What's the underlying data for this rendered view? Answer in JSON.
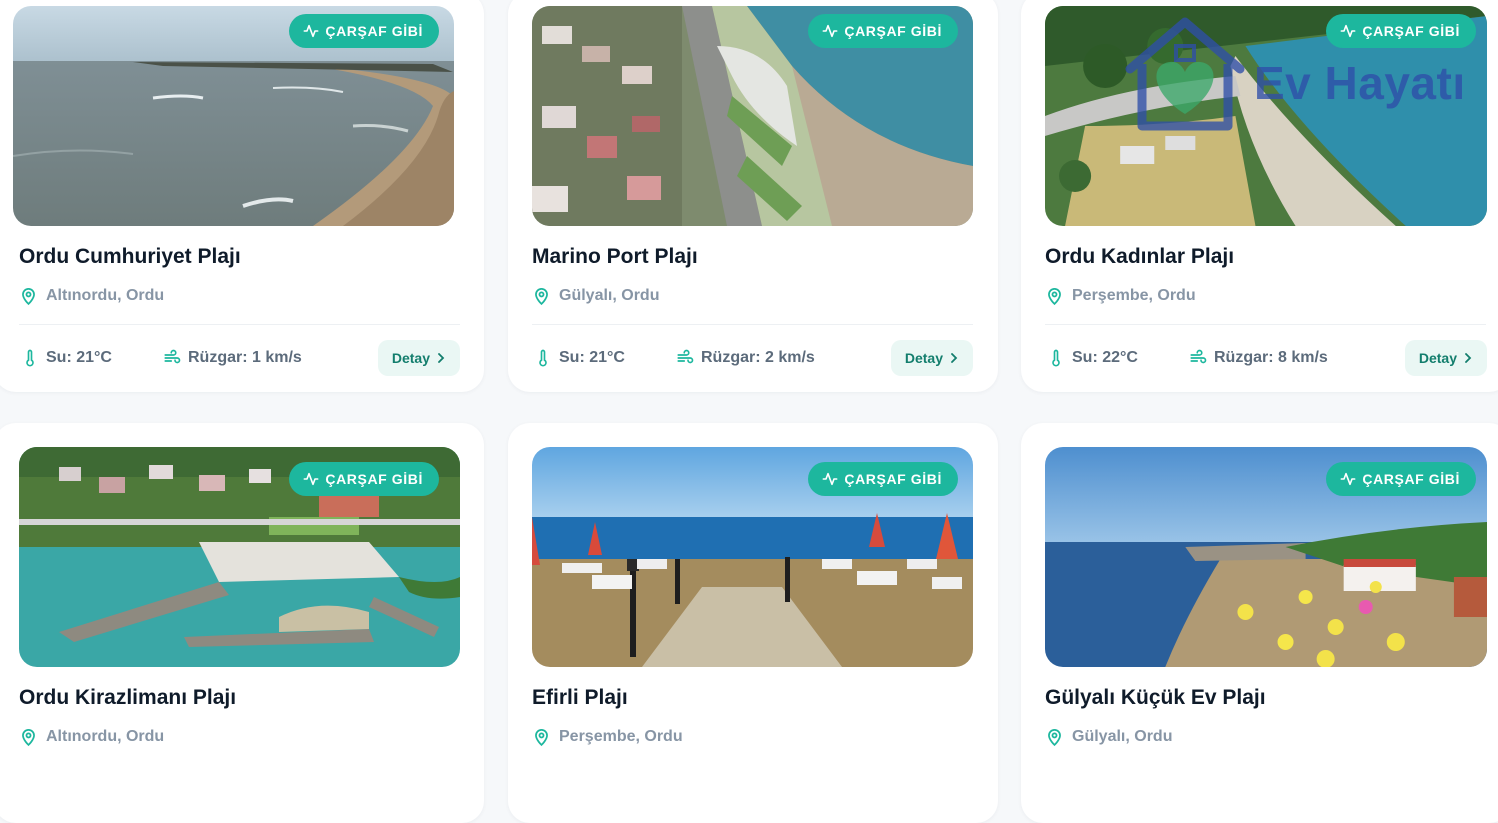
{
  "badge_label": "ÇARŞAF GİBİ",
  "detail_label": "Detay",
  "watermark_text": "Ev Hayatı",
  "colors": {
    "accent": "#1db79e",
    "accent_soft": "#eaf7f4",
    "accent_text": "#137e6d",
    "title": "#0f1b2a",
    "muted": "#8795a5"
  },
  "beaches": [
    {
      "name": "Ordu Cumhuriyet Plajı",
      "location": "Altınordu, Ordu",
      "water": "Su: 21°C",
      "wind": "Rüzgar: 1 km/s"
    },
    {
      "name": "Marino Port Plajı",
      "location": "Gülyalı, Ordu",
      "water": "Su: 21°C",
      "wind": "Rüzgar: 2 km/s"
    },
    {
      "name": "Ordu Kadınlar Plajı",
      "location": "Perşembe, Ordu",
      "water": "Su: 22°C",
      "wind": "Rüzgar: 8 km/s"
    },
    {
      "name": "Ordu Kirazlimanı Plajı",
      "location": "Altınordu, Ordu"
    },
    {
      "name": "Efirli Plajı",
      "location": "Perşembe, Ordu"
    },
    {
      "name": "Gülyalı Küçük Ev Plajı",
      "location": "Gülyalı, Ordu"
    }
  ]
}
